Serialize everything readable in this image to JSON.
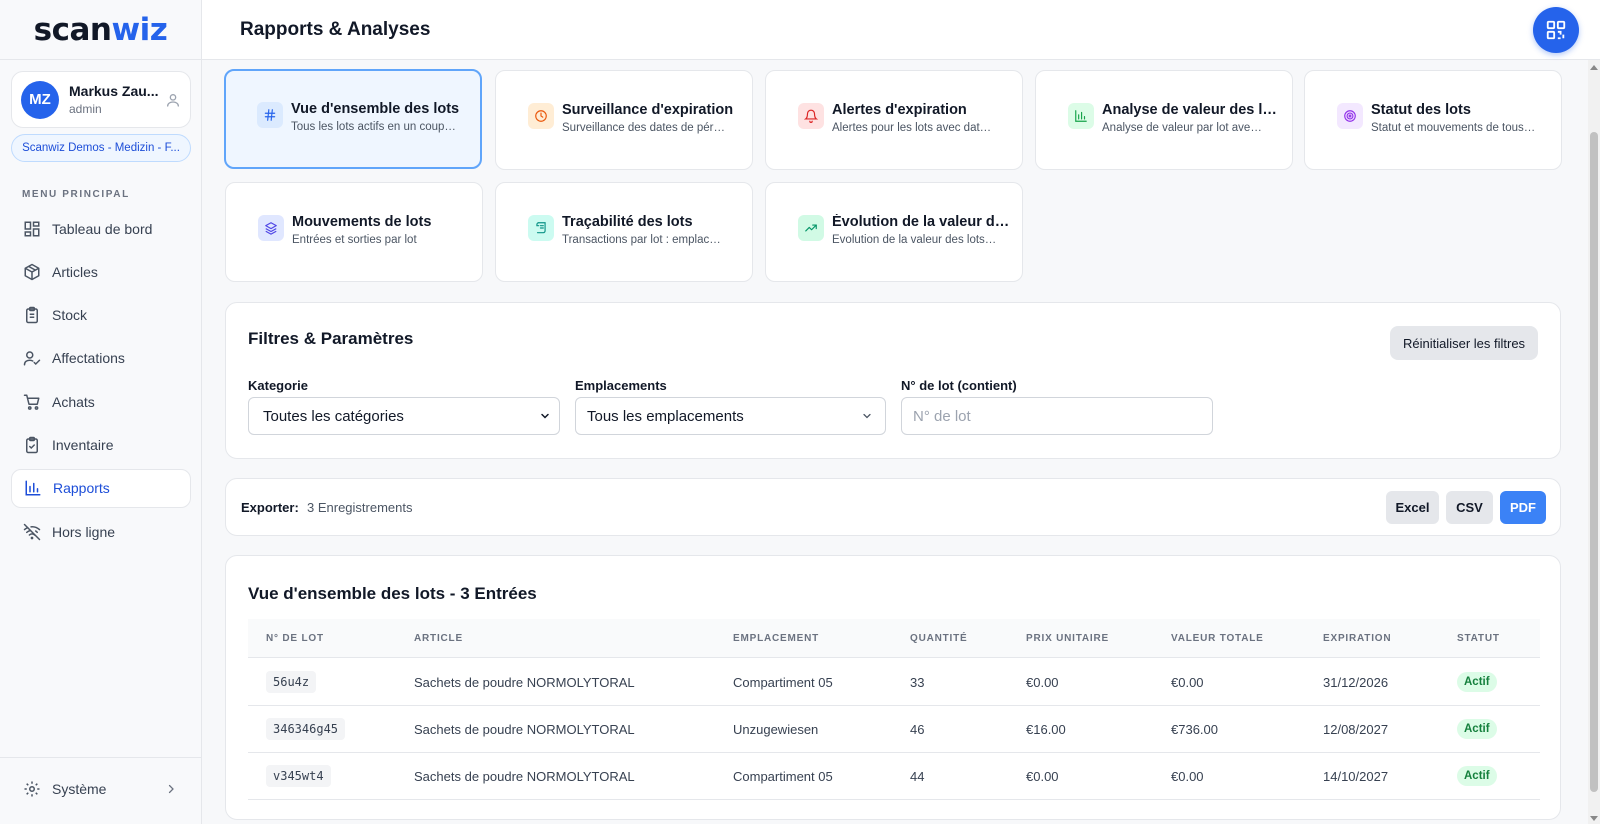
{
  "brand": {
    "part1": "scan",
    "part2": "wiz"
  },
  "user": {
    "initials": "MZ",
    "name": "Markus Zau...",
    "role": "admin"
  },
  "org": "Scanwiz Demos - Medizin - F...",
  "menu_heading": "MENU PRINCIPAL",
  "nav": [
    {
      "label": "Tableau de bord",
      "icon": "dashboard-icon"
    },
    {
      "label": "Articles",
      "icon": "box-icon"
    },
    {
      "label": "Stock",
      "icon": "clipboard-icon"
    },
    {
      "label": "Affectations",
      "icon": "user-check-icon"
    },
    {
      "label": "Achats",
      "icon": "cart-icon"
    },
    {
      "label": "Inventaire",
      "icon": "clipboard-check-icon"
    },
    {
      "label": "Rapports",
      "icon": "bar-chart-icon",
      "active": true
    },
    {
      "label": "Hors ligne",
      "icon": "wifi-off-icon"
    }
  ],
  "system_label": "Système",
  "header": {
    "title": "Rapports & Analyses"
  },
  "cards": [
    {
      "title": "Vue d'ensemble des lots",
      "sub": "Tous les lots actifs en un coup d'œil",
      "icon": "hash-icon",
      "color": "#2563eb",
      "bg": "#dbeafe",
      "active": true
    },
    {
      "title": "Surveillance d'expiration",
      "sub": "Surveillance des dates de péremption",
      "icon": "clock-icon",
      "color": "#ea580c",
      "bg": "#ffedd5"
    },
    {
      "title": "Alertes d'expiration",
      "sub": "Alertes pour les lots avec date proche",
      "icon": "bell-icon",
      "color": "#dc2626",
      "bg": "#fee2e2"
    },
    {
      "title": "Analyse de valeur des lots",
      "sub": "Analyse de valeur par lot avec détails",
      "icon": "bar-chart-icon",
      "color": "#16a34a",
      "bg": "#dcfce7"
    },
    {
      "title": "Statut des lots",
      "sub": "Statut et mouvements de tous les lots",
      "icon": "target-icon",
      "color": "#9333ea",
      "bg": "#f3e8ff"
    },
    {
      "title": "Mouvements de lots",
      "sub": "Entrées et sorties par lot",
      "icon": "layers-icon",
      "color": "#4f46e5",
      "bg": "#e0e7ff"
    },
    {
      "title": "Traçabilité des lots",
      "sub": "Transactions par lot : emplacements",
      "icon": "scroll-icon",
      "color": "#0d9488",
      "bg": "#ccfbf1"
    },
    {
      "title": "Évolution de la valeur des lots",
      "sub": "Évolution de la valeur des lots dans le temps",
      "icon": "trending-up-icon",
      "color": "#059669",
      "bg": "#d1fae5"
    }
  ],
  "filters": {
    "title": "Filtres & Paramètres",
    "reset": "Réinitialiser les filtres",
    "category_label": "Kategorie",
    "category_value": "Toutes les catégories",
    "location_label": "Emplacements",
    "location_value": "Tous les emplacements",
    "lot_label": "N° de lot (contient)",
    "lot_placeholder": "N° de lot"
  },
  "export": {
    "label": "Exporter:",
    "count": "3 Enregistrements",
    "excel": "Excel",
    "csv": "CSV",
    "pdf": "PDF"
  },
  "table": {
    "title": "Vue d'ensemble des lots - 3 Entrées",
    "columns": [
      "N° DE LOT",
      "ARTICLE",
      "EMPLACEMENT",
      "QUANTITÉ",
      "PRIX UNITAIRE",
      "VALEUR TOTALE",
      "EXPIRATION",
      "STATUT"
    ],
    "rows": [
      {
        "lot": "56u4z",
        "article": "Sachets de poudre NORMOLYTORAL",
        "location": "Compartiment 05",
        "qty": "33",
        "unit": "€0.00",
        "total": "€0.00",
        "expiry": "31/12/2026",
        "status": "Actif"
      },
      {
        "lot": "346346g45",
        "article": "Sachets de poudre NORMOLYTORAL",
        "location": "Unzugewiesen",
        "qty": "46",
        "unit": "€16.00",
        "total": "€736.00",
        "expiry": "12/08/2027",
        "status": "Actif"
      },
      {
        "lot": "v345wt4",
        "article": "Sachets de poudre NORMOLYTORAL",
        "location": "Compartiment 05",
        "qty": "44",
        "unit": "€0.00",
        "total": "€0.00",
        "expiry": "14/10/2027",
        "status": "Actif"
      }
    ]
  }
}
